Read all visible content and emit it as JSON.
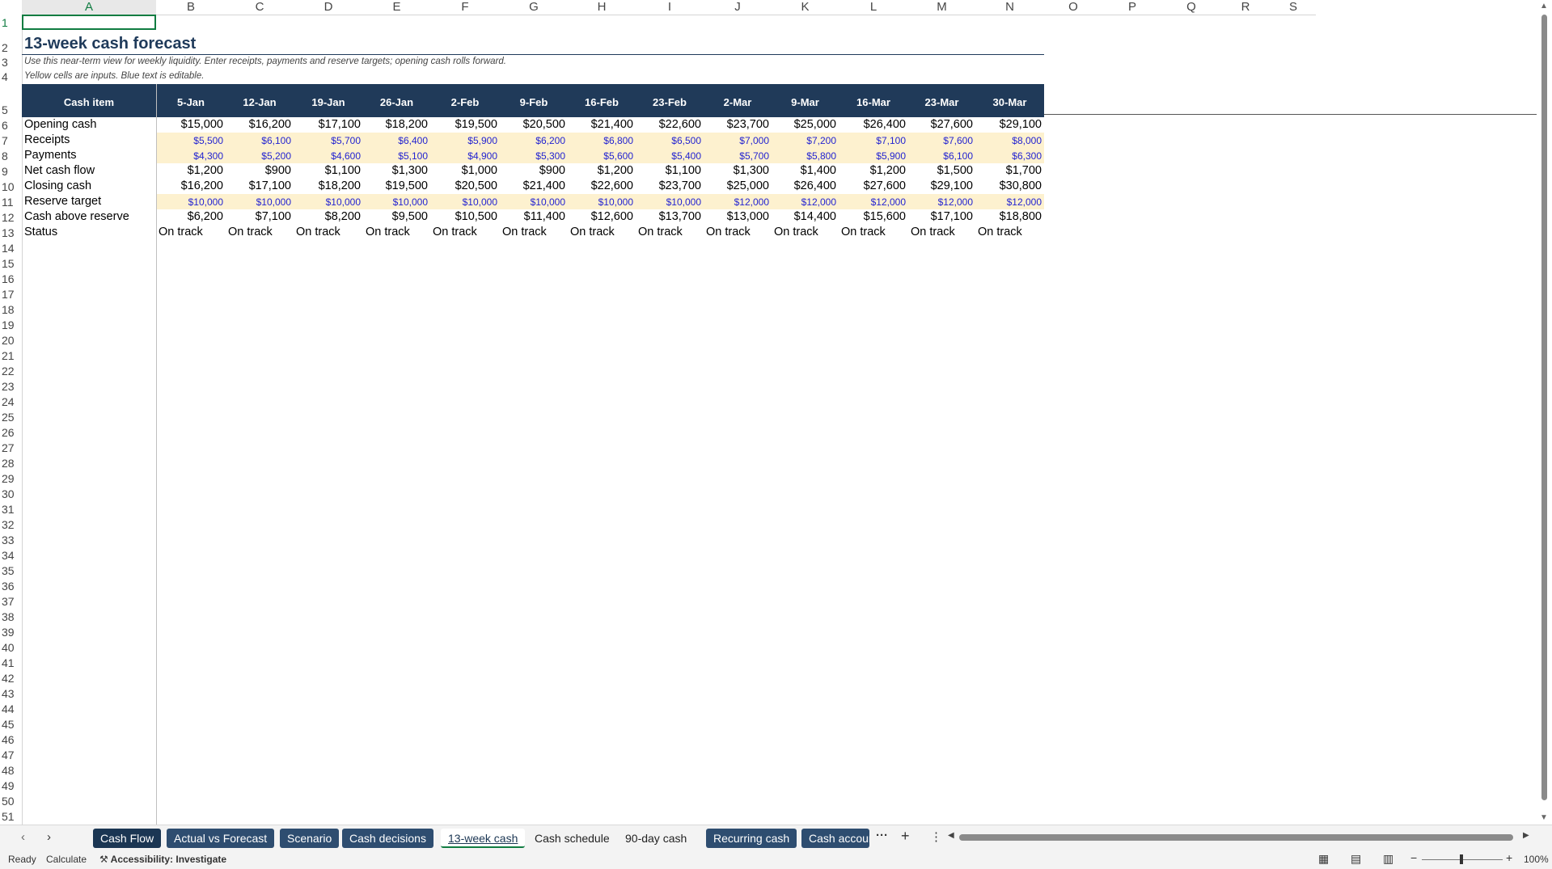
{
  "columns": [
    "A",
    "B",
    "C",
    "D",
    "E",
    "F",
    "G",
    "H",
    "I",
    "J",
    "K",
    "L",
    "M",
    "N",
    "O",
    "P",
    "Q",
    "R",
    "S"
  ],
  "rows_count": 51,
  "title": "13-week cash forecast",
  "note1": "Use this near-term view for weekly liquidity. Enter receipts, payments and reserve targets; opening cash rolls forward.",
  "note2": "Yellow cells are inputs. Blue text is editable.",
  "table": {
    "header_label": "Cash item",
    "weeks": [
      "5-Jan",
      "12-Jan",
      "19-Jan",
      "26-Jan",
      "2-Feb",
      "9-Feb",
      "16-Feb",
      "23-Feb",
      "2-Mar",
      "9-Mar",
      "16-Mar",
      "23-Mar",
      "30-Mar"
    ],
    "rows": [
      {
        "label": "Opening cash",
        "input": false,
        "values": [
          "$15,000",
          "$16,200",
          "$17,100",
          "$18,200",
          "$19,500",
          "$20,500",
          "$21,400",
          "$22,600",
          "$23,700",
          "$25,000",
          "$26,400",
          "$27,600",
          "$29,100"
        ]
      },
      {
        "label": "Receipts",
        "input": true,
        "values": [
          "$5,500",
          "$6,100",
          "$5,700",
          "$6,400",
          "$5,900",
          "$6,200",
          "$6,800",
          "$6,500",
          "$7,000",
          "$7,200",
          "$7,100",
          "$7,600",
          "$8,000"
        ]
      },
      {
        "label": "Payments",
        "input": true,
        "values": [
          "$4,300",
          "$5,200",
          "$4,600",
          "$5,100",
          "$4,900",
          "$5,300",
          "$5,600",
          "$5,400",
          "$5,700",
          "$5,800",
          "$5,900",
          "$6,100",
          "$6,300"
        ]
      },
      {
        "label": "Net cash flow",
        "input": false,
        "values": [
          "$1,200",
          "$900",
          "$1,100",
          "$1,300",
          "$1,000",
          "$900",
          "$1,200",
          "$1,100",
          "$1,300",
          "$1,400",
          "$1,200",
          "$1,500",
          "$1,700"
        ]
      },
      {
        "label": "Closing cash",
        "input": false,
        "values": [
          "$16,200",
          "$17,100",
          "$18,200",
          "$19,500",
          "$20,500",
          "$21,400",
          "$22,600",
          "$23,700",
          "$25,000",
          "$26,400",
          "$27,600",
          "$29,100",
          "$30,800"
        ]
      },
      {
        "label": "Reserve target",
        "input": true,
        "values": [
          "$10,000",
          "$10,000",
          "$10,000",
          "$10,000",
          "$10,000",
          "$10,000",
          "$10,000",
          "$10,000",
          "$12,000",
          "$12,000",
          "$12,000",
          "$12,000",
          "$12,000"
        ]
      },
      {
        "label": "Cash above reserve",
        "input": false,
        "values": [
          "$6,200",
          "$7,100",
          "$8,200",
          "$9,500",
          "$10,500",
          "$11,400",
          "$12,600",
          "$13,700",
          "$13,000",
          "$14,400",
          "$15,600",
          "$17,100",
          "$18,800"
        ]
      },
      {
        "label": "Status",
        "input": false,
        "status": true,
        "values": [
          "On track",
          "On track",
          "On track",
          "On track",
          "On track",
          "On track",
          "On track",
          "On track",
          "On track",
          "On track",
          "On track",
          "On track",
          "On track"
        ]
      }
    ]
  },
  "sheet_tabs": [
    {
      "label": "Cash Flow",
      "style": "dark"
    },
    {
      "label": "Actual vs Forecast",
      "style": "colored"
    },
    {
      "label": "Scenario",
      "style": "colored"
    },
    {
      "label": "Cash decisions",
      "style": "colored"
    },
    {
      "label": "13-week cash",
      "style": "active"
    },
    {
      "label": "Cash schedule",
      "style": "plain"
    },
    {
      "label": "90-day cash",
      "style": "plain"
    },
    {
      "label": "Recurring cash",
      "style": "colored"
    },
    {
      "label": "Cash account",
      "style": "colored"
    }
  ],
  "icons": {
    "prev_sheet": "chevron-left-icon",
    "next_sheet": "chevron-right-icon",
    "more_sheets": "ellipsis-icon",
    "add_sheet": "plus-icon",
    "sheet_menu": "vertical-dots-icon",
    "accessibility": "accessibility-icon"
  },
  "status": {
    "ready": "Ready",
    "calculate": "Calculate",
    "accessibility": "Accessibility: Investigate",
    "zoom": "100%"
  },
  "colors": {
    "header_band": "#203a59",
    "input_fill": "#fdf1cf",
    "input_text": "#2323d0",
    "title": "#1f3a5a",
    "selection": "#107c41"
  }
}
